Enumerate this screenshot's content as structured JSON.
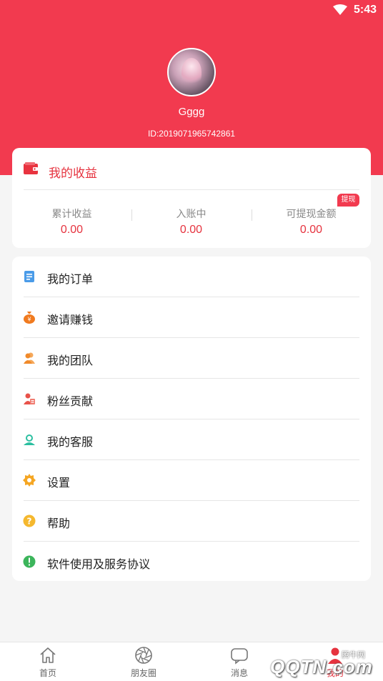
{
  "status_bar": {
    "time": "5:43",
    "wifi_icon": "wifi-icon"
  },
  "profile": {
    "username": "Gggg",
    "user_id": "ID:2019071965742861"
  },
  "earnings": {
    "title": "我的收益",
    "withdraw_badge": "提现",
    "stats": [
      {
        "label": "累计收益",
        "value": "0.00"
      },
      {
        "label": "入账中",
        "value": "0.00"
      },
      {
        "label": "可提现金额",
        "value": "0.00"
      }
    ],
    "accent_color": "#e6333f"
  },
  "menu": [
    {
      "label": "我的订单",
      "icon": "order-icon",
      "color": "#4a9be8"
    },
    {
      "label": "邀请赚钱",
      "icon": "money-bag-icon",
      "color": "#f07a1f"
    },
    {
      "label": "我的团队",
      "icon": "team-icon",
      "color": "#f08a2a"
    },
    {
      "label": "粉丝贡献",
      "icon": "fans-icon",
      "color": "#e8524a"
    },
    {
      "label": "我的客服",
      "icon": "customer-service-icon",
      "color": "#2bbfa0"
    },
    {
      "label": "设置",
      "icon": "gear-icon",
      "color": "#f5a623"
    },
    {
      "label": "帮助",
      "icon": "help-icon",
      "color": "#f5b82e"
    },
    {
      "label": "软件使用及服务协议",
      "icon": "agreement-icon",
      "color": "#3cb55b"
    }
  ],
  "tabbar": [
    {
      "label": "首页",
      "icon": "home-icon"
    },
    {
      "label": "朋友圈",
      "icon": "camera-aperture-icon"
    },
    {
      "label": "消息",
      "icon": "message-icon"
    },
    {
      "label": "我的",
      "icon": "profile-icon",
      "active": true
    }
  ],
  "watermark": {
    "text": "QQTN.com",
    "small": "腾牛网"
  },
  "colors": {
    "header_bg": "#f23a4f",
    "page_bg": "#f5f5f5"
  }
}
